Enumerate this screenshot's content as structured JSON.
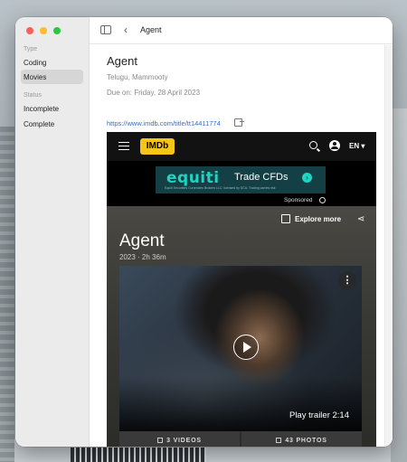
{
  "sidebar": {
    "sections": [
      {
        "title": "Type",
        "items": [
          {
            "label": "Coding"
          },
          {
            "label": "Movies",
            "selected": true
          }
        ]
      },
      {
        "title": "Status",
        "items": [
          {
            "label": "Incomplete"
          },
          {
            "label": "Complete"
          }
        ]
      }
    ]
  },
  "toolbar": {
    "title": "Agent"
  },
  "detail": {
    "title": "Agent",
    "languages": "Telugu, Mammooty",
    "due": "Due on: Friday, 28 April 2023",
    "url": "https://www.imdb.com/title/tt14411774"
  },
  "web": {
    "logo": "IMDb",
    "language": "EN ▾",
    "ad": {
      "brand": "equiti",
      "cta": "Trade CFDs",
      "fine": "Equiti Securities Currencies Brokers LLC, licensed by SCA, Trading carries risk",
      "sponsored": "Sponsored"
    },
    "explore": "Explore more",
    "movie_title": "Agent",
    "year": "2023",
    "runtime": "2h 36m",
    "trailer": "Play trailer  2:14",
    "videos": "3 VIDEOS",
    "photos": "43 PHOTOS"
  },
  "colors": {
    "imdb_yellow": "#f5c518",
    "link": "#2f6fd6",
    "ad_teal": "#22d3c2"
  }
}
